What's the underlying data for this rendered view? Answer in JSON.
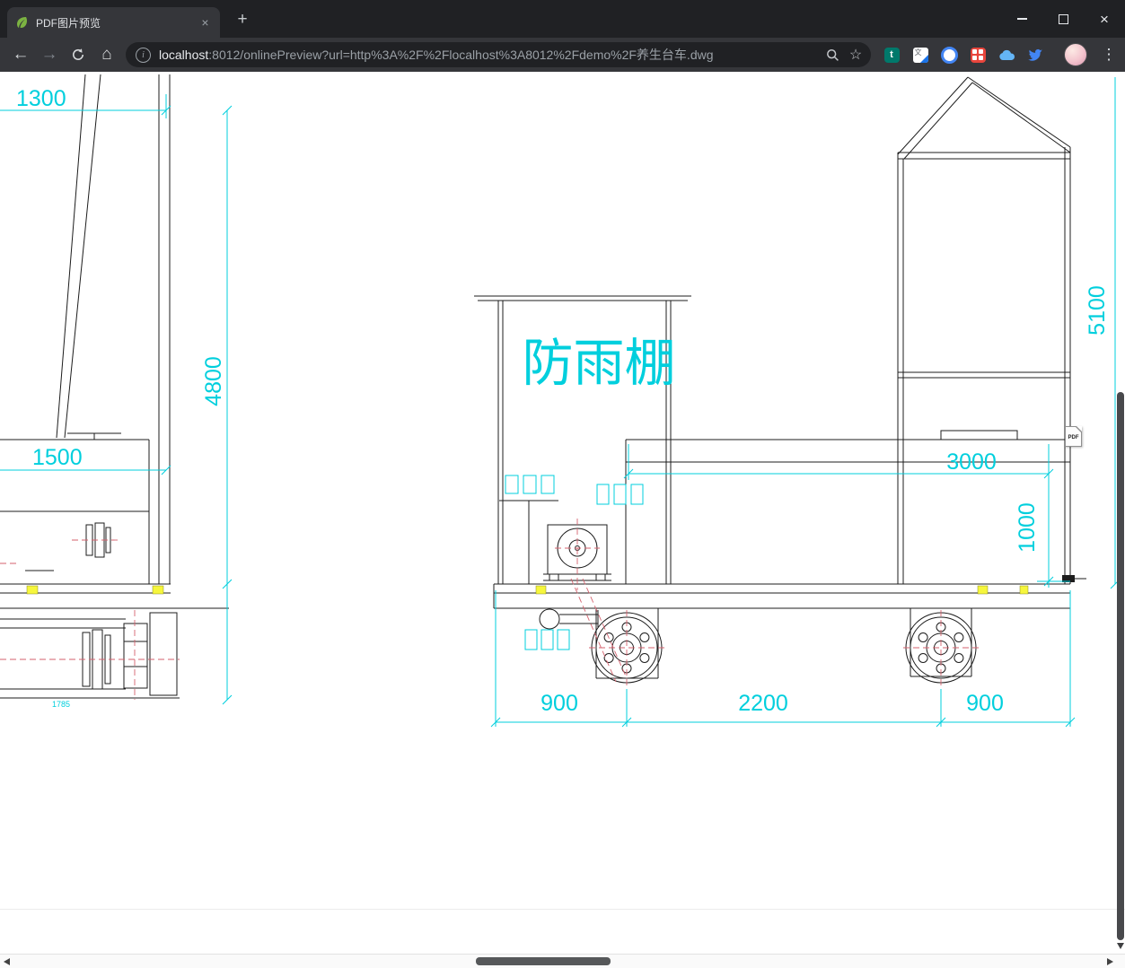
{
  "tab": {
    "title": "PDF图片预览"
  },
  "icons": {
    "close": "×",
    "new_tab": "+",
    "back": "←",
    "forward": "→",
    "home": "⌂",
    "menu": "⋮",
    "bookmark": "☆",
    "info": "i"
  },
  "address": {
    "host": "localhost",
    "path": ":8012/onlinePreview?url=http%3A%2F%2Flocalhost%3A8012%2Fdemo%2F养生台车.dwg"
  },
  "pdf_badge": {
    "label": "PDF"
  },
  "drawing": {
    "shelter_label": "防雨棚",
    "dims": {
      "d1300": "1300",
      "d4800": "4800",
      "d1500": "1500",
      "d1785": "1785",
      "d3000": "3000",
      "d1000": "1000",
      "d5100": "5100",
      "d900_left": "900",
      "d2200": "2200",
      "d900_right": "900"
    },
    "colors": {
      "dimension": "#00CFDD",
      "line": "#1C1C1C",
      "centerline": "#D4626E",
      "highlight": "#F6F63C"
    }
  }
}
